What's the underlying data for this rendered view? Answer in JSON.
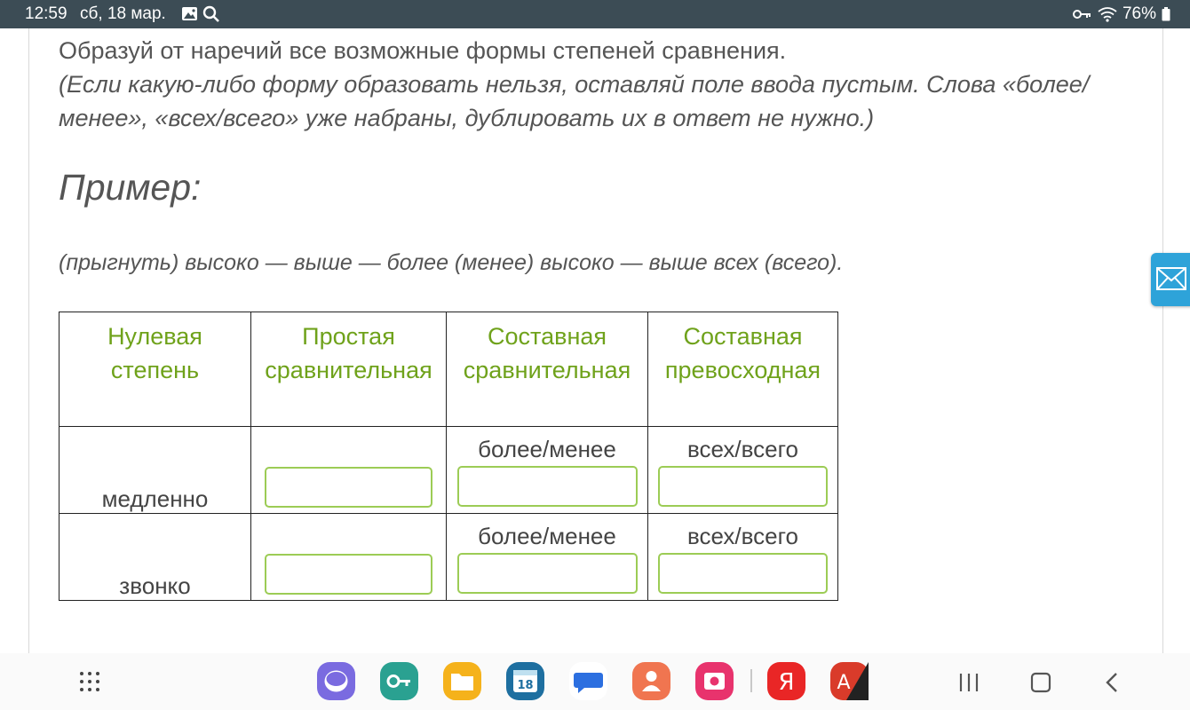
{
  "status_bar": {
    "time": "12:59",
    "date": "сб, 18 мар.",
    "battery": "76%"
  },
  "exercise": {
    "instruction": "Образуй от наречий все возможные формы степеней сравнения.",
    "note": "(Если какую-либо форму образовать нельзя, оставляй поле ввода пустым. Слова «более/менее», «всех/всего» уже набраны, дублировать их в ответ не нужно.)",
    "example_heading": "Пример:",
    "example_text": "(прыгнуть) высоко — выше — более (менее) высоко — выше всех (всего).",
    "table": {
      "headers": [
        "Нулевая степень",
        "Простая сравнительная",
        "Составная сравнительная",
        "Составная превосходная"
      ],
      "rows": [
        {
          "word": "медленно",
          "comp_prefix": "более/менее",
          "sup_prefix": "всех/всего",
          "simple_value": "",
          "comp_value": "",
          "sup_value": ""
        },
        {
          "word": "звонко",
          "comp_prefix": "более/менее",
          "sup_prefix": "всех/всего",
          "simple_value": "",
          "comp_value": "",
          "sup_value": ""
        }
      ]
    }
  },
  "side_tab": {
    "icon": "mail-icon",
    "color": "#2ea3d9"
  },
  "colors": {
    "header_green": "#6fa21b",
    "input_border": "#9ccc55",
    "status_bar": "#3c4c55"
  },
  "navbar": {
    "apps": [
      {
        "name": "samsung-internet-icon",
        "color": "#7a6be0"
      },
      {
        "name": "password-manager-icon",
        "color": "#2aa191"
      },
      {
        "name": "my-files-icon",
        "color": "#f5b21b"
      },
      {
        "name": "calendar-icon",
        "color": "#1e6fa0",
        "label": "18"
      },
      {
        "name": "messages-icon",
        "color": "#2c6fe0"
      },
      {
        "name": "contacts-icon",
        "color": "#f07550"
      },
      {
        "name": "screen-recorder-icon",
        "color": "#e8336d"
      },
      {
        "name": "yandex-browser-icon",
        "color": "#e92626",
        "label": "Я"
      },
      {
        "name": "translate-icon",
        "color": "#d93b2a",
        "label": "A"
      }
    ]
  }
}
